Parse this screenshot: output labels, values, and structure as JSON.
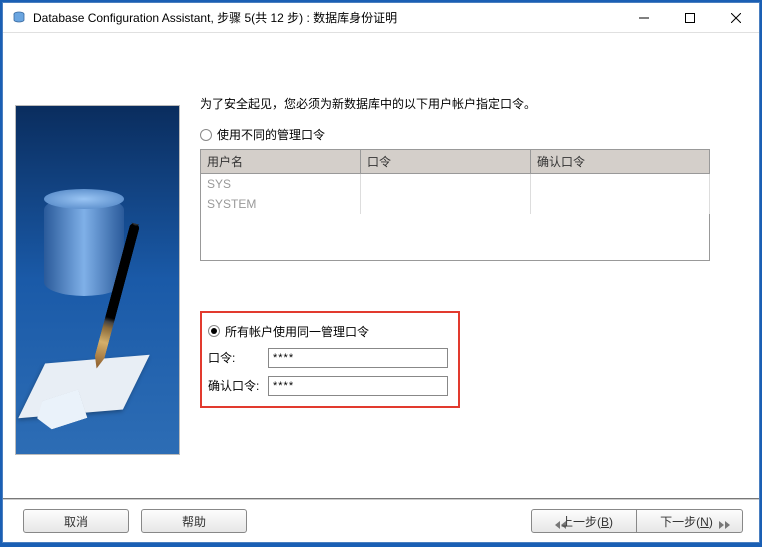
{
  "window": {
    "title": "Database Configuration Assistant, 步骤 5(共 12 步) : 数据库身份证明"
  },
  "instruction": "为了安全起见，您必须为新数据库中的以下用户帐户指定口令。",
  "options": {
    "different": {
      "label": "使用不同的管理口令",
      "selected": false
    },
    "same": {
      "label": "所有帐户使用同一管理口令",
      "selected": true
    }
  },
  "table": {
    "headers": {
      "user": "用户名",
      "password": "口令",
      "confirm": "确认口令"
    },
    "rows": [
      {
        "user": "SYS",
        "password": "",
        "confirm": ""
      },
      {
        "user": "SYSTEM",
        "password": "",
        "confirm": ""
      }
    ]
  },
  "password_fields": {
    "password_label": "口令:",
    "password_value": "****",
    "confirm_label": "确认口令:",
    "confirm_value": "****"
  },
  "buttons": {
    "cancel": "取消",
    "help": "帮助",
    "back": "上一步(B)",
    "next": "下一步(N)"
  }
}
